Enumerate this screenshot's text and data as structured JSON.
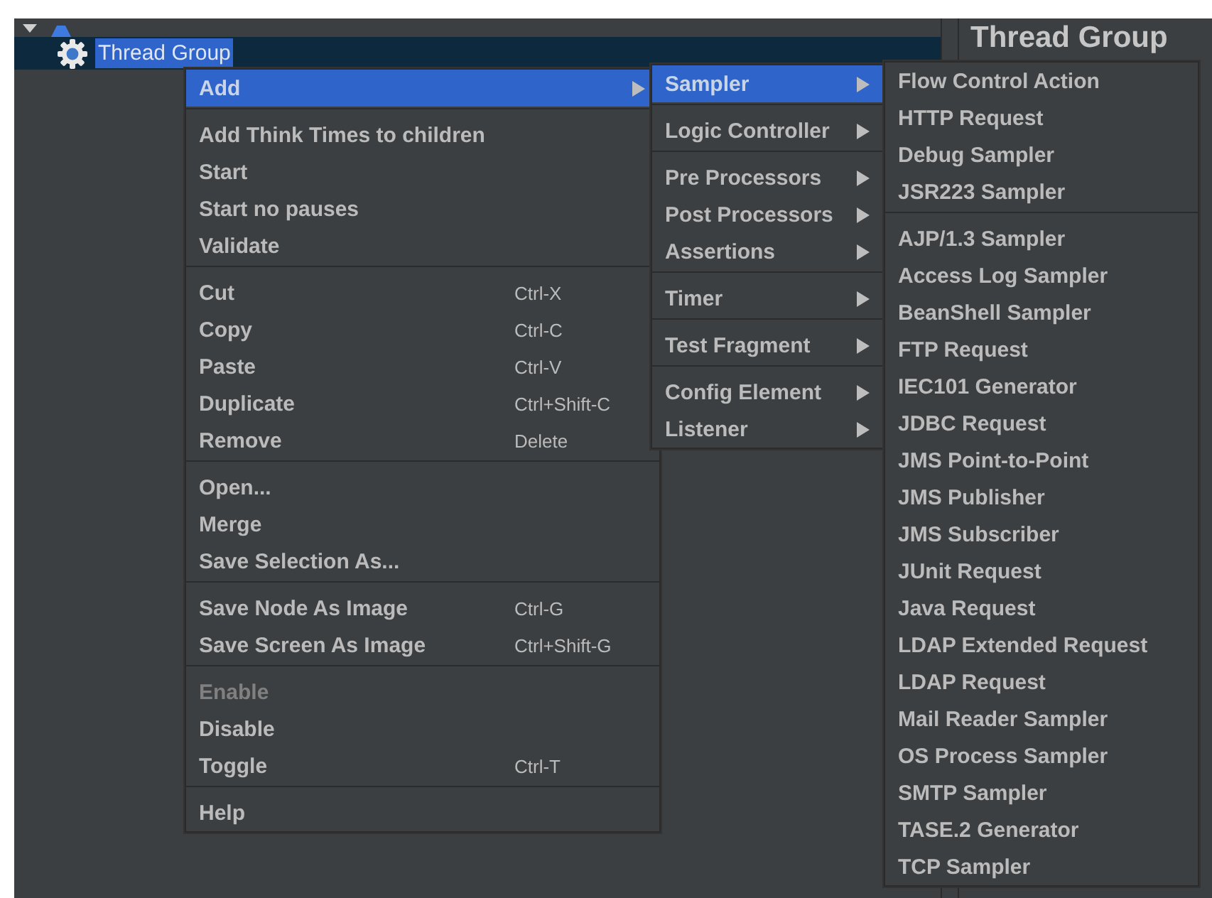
{
  "tree": {
    "node": {
      "label": "Thread Group",
      "selected": true
    }
  },
  "panel": {
    "title": "Thread Group"
  },
  "context_menu": {
    "groups": [
      [
        {
          "label": "Add",
          "submenu": true,
          "selected": true,
          "disabled": false
        }
      ],
      [
        {
          "label": "Add Think Times to children",
          "submenu": false,
          "selected": false,
          "disabled": false
        },
        {
          "label": "Start",
          "submenu": false,
          "selected": false,
          "disabled": false
        },
        {
          "label": "Start no pauses",
          "submenu": false,
          "selected": false,
          "disabled": false
        },
        {
          "label": "Validate",
          "submenu": false,
          "selected": false,
          "disabled": false
        }
      ],
      [
        {
          "label": "Cut",
          "shortcut": "Ctrl-X",
          "submenu": false,
          "selected": false,
          "disabled": false
        },
        {
          "label": "Copy",
          "shortcut": "Ctrl-C",
          "submenu": false,
          "selected": false,
          "disabled": false
        },
        {
          "label": "Paste",
          "shortcut": "Ctrl-V",
          "submenu": false,
          "selected": false,
          "disabled": false
        },
        {
          "label": "Duplicate",
          "shortcut": "Ctrl+Shift-C",
          "submenu": false,
          "selected": false,
          "disabled": false
        },
        {
          "label": "Remove",
          "shortcut": "Delete",
          "submenu": false,
          "selected": false,
          "disabled": false
        }
      ],
      [
        {
          "label": "Open...",
          "submenu": false,
          "selected": false,
          "disabled": false
        },
        {
          "label": "Merge",
          "submenu": false,
          "selected": false,
          "disabled": false
        },
        {
          "label": "Save Selection As...",
          "submenu": false,
          "selected": false,
          "disabled": false
        }
      ],
      [
        {
          "label": "Save Node As Image",
          "shortcut": "Ctrl-G",
          "submenu": false,
          "selected": false,
          "disabled": false
        },
        {
          "label": "Save Screen As Image",
          "shortcut": "Ctrl+Shift-G",
          "submenu": false,
          "selected": false,
          "disabled": false
        }
      ],
      [
        {
          "label": "Enable",
          "submenu": false,
          "selected": false,
          "disabled": true
        },
        {
          "label": "Disable",
          "submenu": false,
          "selected": false,
          "disabled": false
        },
        {
          "label": "Toggle",
          "shortcut": "Ctrl-T",
          "submenu": false,
          "selected": false,
          "disabled": false
        }
      ],
      [
        {
          "label": "Help",
          "submenu": false,
          "selected": false,
          "disabled": false
        }
      ]
    ]
  },
  "add_submenu": {
    "groups": [
      [
        {
          "label": "Sampler",
          "submenu": true,
          "selected": true
        }
      ],
      [
        {
          "label": "Logic Controller",
          "submenu": true,
          "selected": false
        }
      ],
      [
        {
          "label": "Pre Processors",
          "submenu": true,
          "selected": false
        },
        {
          "label": "Post Processors",
          "submenu": true,
          "selected": false
        },
        {
          "label": "Assertions",
          "submenu": true,
          "selected": false
        }
      ],
      [
        {
          "label": "Timer",
          "submenu": true,
          "selected": false
        }
      ],
      [
        {
          "label": "Test Fragment",
          "submenu": true,
          "selected": false
        }
      ],
      [
        {
          "label": "Config Element",
          "submenu": true,
          "selected": false
        },
        {
          "label": "Listener",
          "submenu": true,
          "selected": false
        }
      ]
    ]
  },
  "sampler_submenu": {
    "groups": [
      [
        {
          "label": "Flow Control Action",
          "submenu": false,
          "selected": false
        },
        {
          "label": "HTTP Request",
          "submenu": false,
          "selected": false
        },
        {
          "label": "Debug Sampler",
          "submenu": false,
          "selected": false
        },
        {
          "label": "JSR223 Sampler",
          "submenu": false,
          "selected": false
        }
      ],
      [
        {
          "label": "AJP/1.3 Sampler",
          "submenu": false,
          "selected": false
        },
        {
          "label": "Access Log Sampler",
          "submenu": false,
          "selected": false
        },
        {
          "label": "BeanShell Sampler",
          "submenu": false,
          "selected": false
        },
        {
          "label": "FTP Request",
          "submenu": false,
          "selected": false
        },
        {
          "label": "IEC101 Generator",
          "submenu": false,
          "selected": false
        },
        {
          "label": "JDBC Request",
          "submenu": false,
          "selected": false
        },
        {
          "label": "JMS Point-to-Point",
          "submenu": false,
          "selected": false
        },
        {
          "label": "JMS Publisher",
          "submenu": false,
          "selected": false
        },
        {
          "label": "JMS Subscriber",
          "submenu": false,
          "selected": false
        },
        {
          "label": "JUnit Request",
          "submenu": false,
          "selected": false
        },
        {
          "label": "Java Request",
          "submenu": false,
          "selected": false
        },
        {
          "label": "LDAP Extended Request",
          "submenu": false,
          "selected": false
        },
        {
          "label": "LDAP Request",
          "submenu": false,
          "selected": false
        },
        {
          "label": "Mail Reader Sampler",
          "submenu": false,
          "selected": false
        },
        {
          "label": "OS Process Sampler",
          "submenu": false,
          "selected": false
        },
        {
          "label": "SMTP Sampler",
          "submenu": false,
          "selected": false
        },
        {
          "label": "TASE.2 Generator",
          "submenu": false,
          "selected": false
        },
        {
          "label": "TCP Sampler",
          "submenu": false,
          "selected": false
        }
      ]
    ]
  }
}
